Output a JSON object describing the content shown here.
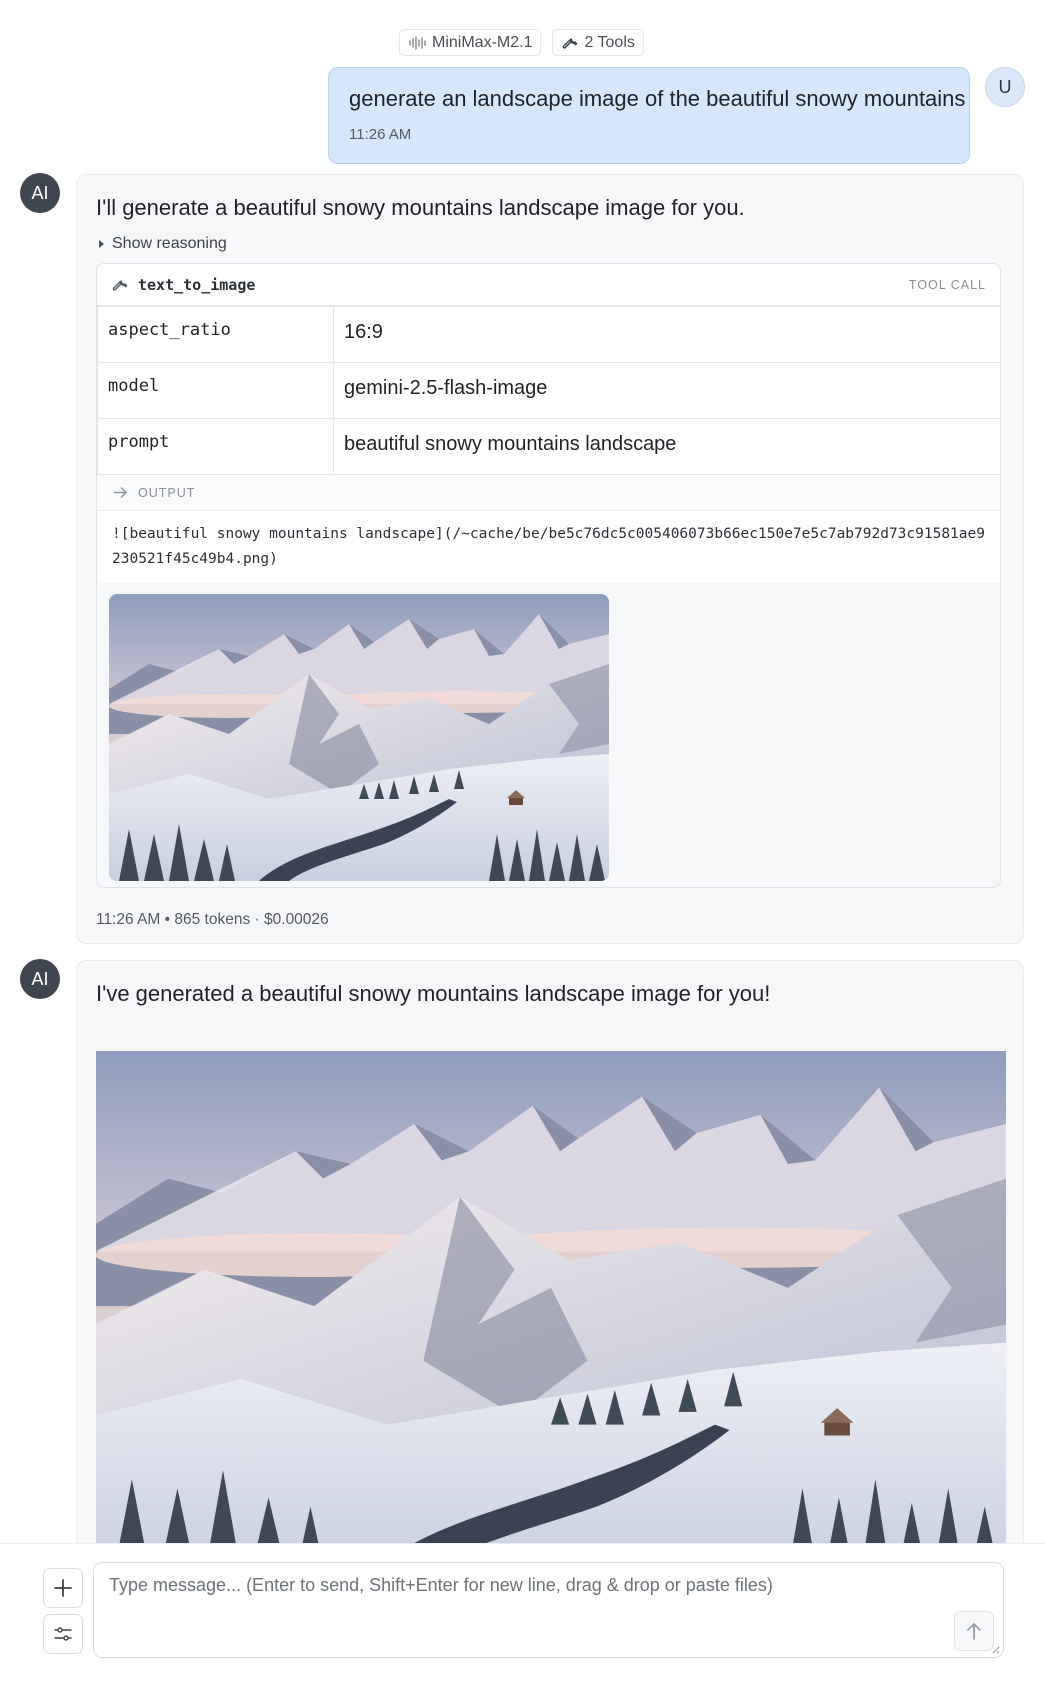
{
  "header": {
    "model_chip": {
      "icon": "waveform-icon",
      "label": "MiniMax-M2.1"
    },
    "tools_chip": {
      "icon": "wrench-icon",
      "label": "2 Tools"
    }
  },
  "user_message": {
    "avatar": "U",
    "text": "generate an landscape image of the beautiful snowy mountains",
    "time": "11:26 AM"
  },
  "ai_message_1": {
    "avatar": "AI",
    "text": "I'll generate a beautiful snowy mountains landscape image for you.",
    "reasoning_label": "Show reasoning",
    "tool_call": {
      "name": "text_to_image",
      "tag": "TOOL CALL",
      "args": [
        {
          "key": "aspect_ratio",
          "value": "16:9"
        },
        {
          "key": "model",
          "value": "gemini-2.5-flash-image"
        },
        {
          "key": "prompt",
          "value": "beautiful snowy mountains landscape"
        }
      ],
      "output_label": "OUTPUT",
      "output_text": "![beautiful snowy mountains landscape](/~cache/be/be5c76dc5c005406073b66ec150e7e5c7ab792d73c91581ae9230521f45c49b4.png)"
    },
    "meta": {
      "time": "11:26 AM",
      "sep": " • ",
      "tokens": "865 tokens",
      "sep2": " · ",
      "cost": "$0.00026"
    }
  },
  "ai_message_2": {
    "avatar": "AI",
    "text": "I've generated a beautiful snowy mountains landscape image for you!"
  },
  "composer": {
    "placeholder": "Type message... (Enter to send, Shift+Enter for new line, drag & drop or paste files)",
    "add_icon": "plus-icon",
    "settings_icon": "sliders-icon",
    "send_icon": "arrow-up-icon"
  },
  "colors": {
    "user_bubble": "#d6e6fb",
    "ai_avatar": "#3f4650",
    "card_bg": "#f6f7f8"
  }
}
